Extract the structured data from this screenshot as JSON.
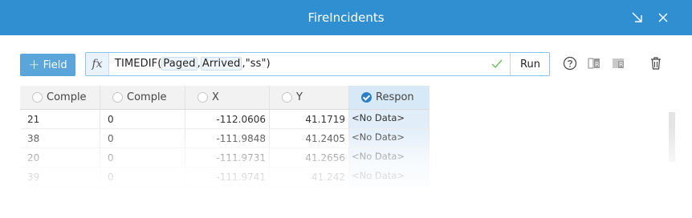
{
  "window": {
    "title": "FireIncidents",
    "icons": [
      "minimize-arrow-icon",
      "close-icon"
    ]
  },
  "toolbar": {
    "add_field_label": "Field",
    "fx_label": "fx",
    "expression_prefix": "TIMEDIF(",
    "expression_arg1": "Paged",
    "expression_comma": ",",
    "expression_arg2": "Arrived",
    "expression_suffix": ",\"ss\")",
    "run_label": "Run",
    "icons": [
      "valid-check-icon",
      "help-icon",
      "calculate-icon",
      "calculate-selected-icon",
      "delete-icon"
    ],
    "accent": "#2f8fd0"
  },
  "table": {
    "columns": [
      {
        "label": "Comple",
        "selected": false
      },
      {
        "label": "Comple",
        "selected": false
      },
      {
        "label": "X",
        "selected": false
      },
      {
        "label": "Y",
        "selected": false
      },
      {
        "label": "Respon",
        "selected": true
      }
    ],
    "rows": [
      [
        "21",
        "0",
        "-112.0606",
        "41.1719",
        "<No Data>"
      ],
      [
        "38",
        "0",
        "-111.9848",
        "41.2405",
        "<No Data>"
      ],
      [
        "20",
        "0",
        "-111.9731",
        "41.2656",
        "<No Data>"
      ],
      [
        "39",
        "0",
        "-111.9741",
        "41.242",
        "<No Data>"
      ]
    ]
  }
}
